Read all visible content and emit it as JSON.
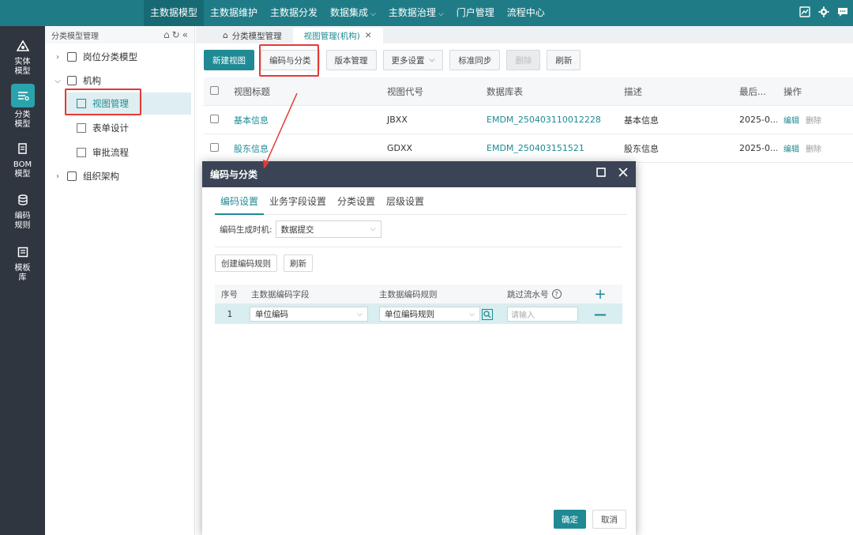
{
  "topnav": {
    "items": [
      {
        "label": "主数据模型",
        "dropdown": false
      },
      {
        "label": "主数据维护",
        "dropdown": false
      },
      {
        "label": "主数据分发",
        "dropdown": false
      },
      {
        "label": "数据集成",
        "dropdown": true
      },
      {
        "label": "主数据治理",
        "dropdown": true
      },
      {
        "label": "门户管理",
        "dropdown": false
      },
      {
        "label": "流程中心",
        "dropdown": false
      }
    ],
    "active_index": 0,
    "right_icons": [
      "chart-icon",
      "gear-icon",
      "message-icon"
    ]
  },
  "rail": {
    "items": [
      {
        "label1": "实体",
        "label2": "模型",
        "icon": "entity-model-icon"
      },
      {
        "label1": "分类",
        "label2": "模型",
        "icon": "classify-model-icon"
      },
      {
        "label1": "BOM",
        "label2": "模型",
        "icon": "bom-model-icon"
      },
      {
        "label1": "编码",
        "label2": "规则",
        "icon": "code-rule-icon"
      },
      {
        "label1": "模板",
        "label2": "库",
        "icon": "template-lib-icon"
      }
    ],
    "active_index": 1
  },
  "tree": {
    "header": "分类模型管理",
    "nodes": [
      {
        "label": "岗位分类模型",
        "expanded": false
      },
      {
        "label": "机构",
        "expanded": true
      },
      {
        "label": "视图管理"
      },
      {
        "label": "表单设计"
      },
      {
        "label": "审批流程"
      },
      {
        "label": "组织架构",
        "expanded": false
      }
    ]
  },
  "tabs": {
    "home": "分类模型管理",
    "active": "视图管理(机构)"
  },
  "toolbar": {
    "new_view": "新建视图",
    "code_classify": "编码与分类",
    "version": "版本管理",
    "more": "更多设置",
    "sync": "标准同步",
    "delete": "删除",
    "refresh": "刷新"
  },
  "grid": {
    "columns": [
      "视图标题",
      "视图代号",
      "数据库表",
      "描述",
      "最后...",
      "操作"
    ],
    "rows": [
      {
        "title": "基本信息",
        "code": "JBXX",
        "table": "EMDM_250403110012228",
        "desc": "基本信息",
        "last": "2025-0..."
      },
      {
        "title": "股东信息",
        "code": "GDXX",
        "table": "EMDM_250403151521",
        "desc": "股东信息",
        "last": "2025-0..."
      }
    ],
    "op_edit": "编辑",
    "op_delete": "删除"
  },
  "dialog": {
    "title": "编码与分类",
    "tabs": [
      "编码设置",
      "业务字段设置",
      "分类设置",
      "层级设置"
    ],
    "active_tab": 0,
    "timing_label": "编码生成时机:",
    "timing_value": "数据提交",
    "create_rule": "创建编码规则",
    "refresh": "刷新",
    "table": {
      "columns": [
        "序号",
        "主数据编码字段",
        "主数据编码规则",
        "跳过流水号"
      ],
      "rows": [
        {
          "seq": "1",
          "field": "单位编码",
          "rule": "单位编码规则",
          "skip_placeholder": "请输入"
        }
      ]
    },
    "ok": "确定",
    "cancel": "取消"
  },
  "colors": {
    "topbar": "#1f7c87",
    "accent": "#1f8a94",
    "rail": "#2f3640",
    "dialog_header": "#3b4456",
    "highlight": "#e53935"
  }
}
